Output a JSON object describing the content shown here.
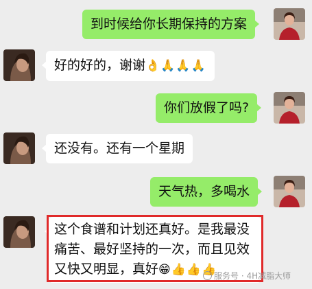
{
  "messages": [
    {
      "side": "right",
      "text": "到时候给你长期保持的方案"
    },
    {
      "side": "left",
      "text": "好的好的，谢谢",
      "emoji": "👌🙏🙏🙏"
    },
    {
      "side": "right",
      "text": "你们放假了吗?"
    },
    {
      "side": "left",
      "text": "还没有。还有一个星期"
    },
    {
      "side": "right",
      "text": "天气热，多喝水"
    },
    {
      "side": "left",
      "lines": [
        "这个食谱和计划还真好。是我最没",
        "痛苦、最好坚持的一次，而且见效",
        "又快又明显，真好"
      ],
      "emoji": "😁👍👍👍"
    }
  ],
  "watermark": {
    "label": "服务号 · 4H减脂大师"
  },
  "colors": {
    "right_bubble": "#95ec69",
    "left_bubble": "#ffffff",
    "background": "#ededed",
    "highlight": "#e02a2a"
  }
}
